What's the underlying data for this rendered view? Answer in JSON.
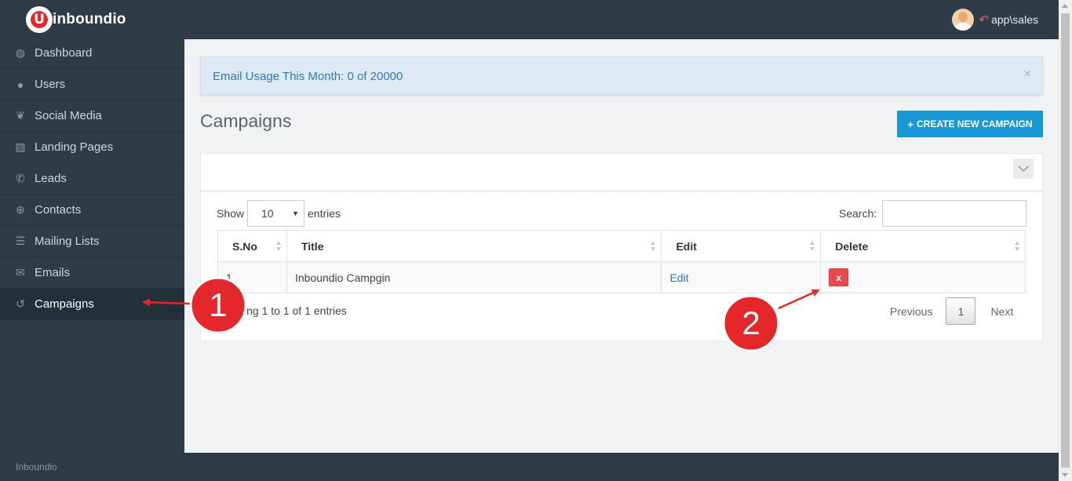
{
  "app": {
    "logo_text": "inboundio",
    "user_name": "app\\sales",
    "footer_text": "Inboundio"
  },
  "sidebar": {
    "items": [
      {
        "label": "Dashboard",
        "icon": "globe-icon"
      },
      {
        "label": "Users",
        "icon": "users-icon"
      },
      {
        "label": "Social Media",
        "icon": "twitter-icon"
      },
      {
        "label": "Landing Pages",
        "icon": "image-icon"
      },
      {
        "label": "Leads",
        "icon": "phone-icon"
      },
      {
        "label": "Contacts",
        "icon": "crosshair-icon"
      },
      {
        "label": "Mailing Lists",
        "icon": "list-icon"
      },
      {
        "label": "Emails",
        "icon": "envelope-icon"
      },
      {
        "label": "Campaigns",
        "icon": "history-icon",
        "active": true
      }
    ]
  },
  "alert": {
    "text": "Email Usage This Month: 0 of 20000",
    "close": "×"
  },
  "main": {
    "title": "Campaigns",
    "create_button": "CREATE NEW CAMPAIGN",
    "create_icon": "+"
  },
  "table_controls": {
    "show_label": "Show",
    "entries_value": "10",
    "entries_label": "entries",
    "search_label": "Search:",
    "search_value": ""
  },
  "table": {
    "headers": [
      "S.No",
      "Title",
      "Edit",
      "Delete"
    ],
    "rows": [
      {
        "sno": "1",
        "title": "Inboundio Campgin",
        "edit": "Edit",
        "delete": "x"
      }
    ]
  },
  "footer": {
    "info": "Showing 1 to 1 of 1 entries",
    "previous": "Previous",
    "page": "1",
    "next": "Next"
  },
  "annotations": {
    "badge_1": "1",
    "badge_2": "2",
    "color": "#e4272b"
  }
}
